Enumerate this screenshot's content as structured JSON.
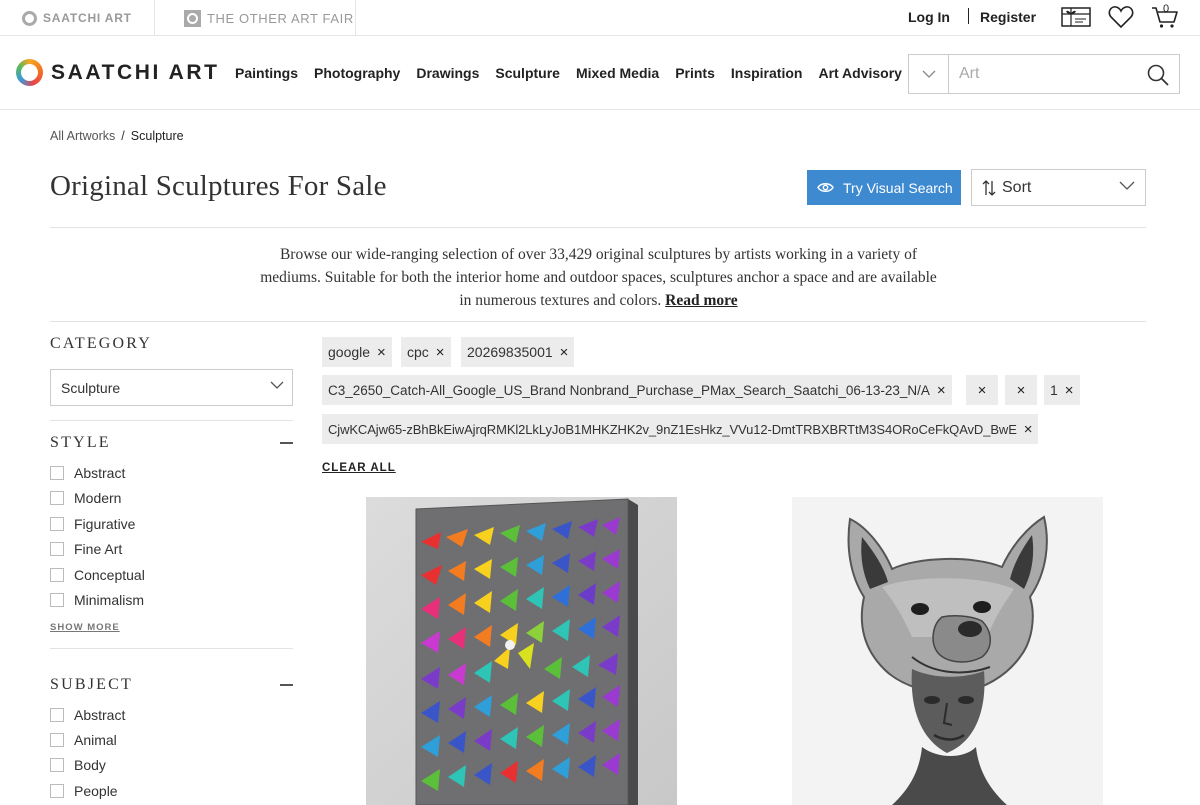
{
  "topbar": {
    "saatchi_tab": "SAATCHI ART",
    "toaf_tab": "THE OTHER ART FAIR",
    "login": "Log In",
    "register": "Register",
    "cart_count": "0"
  },
  "nav": {
    "logo": "SAATCHI ART",
    "links": [
      "Paintings",
      "Photography",
      "Drawings",
      "Sculpture",
      "Mixed Media",
      "Prints",
      "Inspiration",
      "Art Advisory"
    ],
    "search_placeholder": "Art"
  },
  "breadcrumb": {
    "root": "All Artworks",
    "separator": "/",
    "current": "Sculpture"
  },
  "page": {
    "title": "Original Sculptures For Sale",
    "visual_search": "Try Visual Search",
    "sort": "Sort",
    "description": "Browse our wide-ranging selection of over 33,429 original sculptures by artists working in a variety of mediums. Suitable for both the interior home and outdoor spaces, sculptures anchor a space and are available in numerous textures and colors.",
    "read_more": "Read more",
    "accent_color": "#3d8ad1"
  },
  "sidebar": {
    "category": {
      "heading": "CATEGORY",
      "selected": "Sculpture"
    },
    "style": {
      "heading": "STYLE",
      "options": [
        "Abstract",
        "Modern",
        "Figurative",
        "Fine Art",
        "Conceptual",
        "Minimalism"
      ],
      "show_more": "SHOW MORE"
    },
    "subject": {
      "heading": "SUBJECT",
      "options": [
        "Abstract",
        "Animal",
        "Body",
        "People"
      ]
    }
  },
  "filters": {
    "chips": [
      "google",
      "cpc",
      "20269835001",
      "C3_2650_Catch-All_Google_US_Brand Nonbrand_Purchase_PMax_Search_Saatchi_06-13-23_N/A",
      "",
      "",
      "1",
      "CjwKCAjw65-zBhBkEiwAjrqRMKl2LkLyJoB1MHKZHK2v_9nZ1EsHkz_VVu12-DmtTRBXBRTtM3S4ORoCeFkQAvD_BwE"
    ],
    "remove_glyph": "×",
    "clear_all": "CLEAR ALL"
  },
  "artworks": [
    {
      "name": "colorful-wall-sculpture"
    },
    {
      "name": "wolf-mask-bust-sculpture"
    }
  ]
}
